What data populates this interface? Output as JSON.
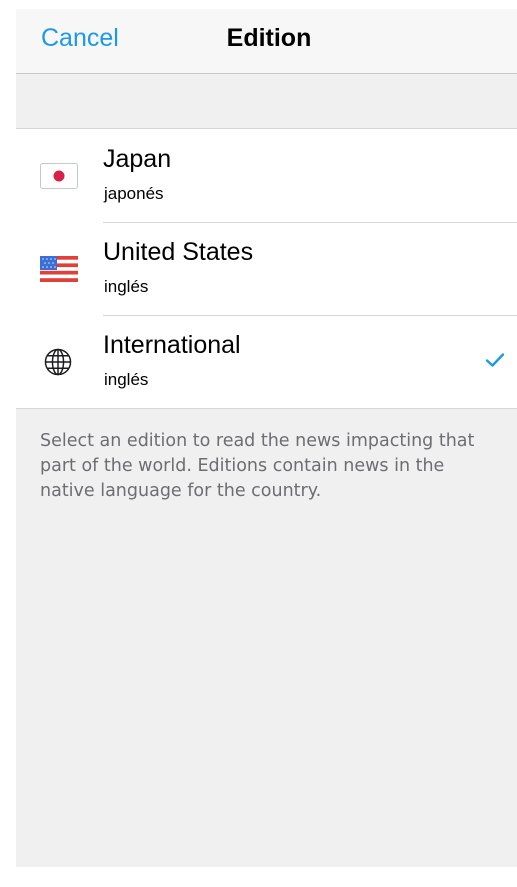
{
  "nav": {
    "cancel_label": "Cancel",
    "title": "Edition"
  },
  "editions": [
    {
      "name": "Japan",
      "language": "japonés",
      "icon": "japan-flag-icon",
      "selected": false
    },
    {
      "name": "United States",
      "language": "inglés",
      "icon": "us-flag-icon",
      "selected": false
    },
    {
      "name": "International",
      "language": "inglés",
      "icon": "globe-icon",
      "selected": true
    }
  ],
  "footer_note": "Select an edition to read the news impacting that part of the world. Editions contain news in the native language for the country.",
  "colors": {
    "accent": "#1a9ae8",
    "background": "#f0f0f1",
    "secondary_text": "#6d6d72",
    "japan_red": "#d8204a",
    "us_red": "#e0403a",
    "us_blue": "#3a6fd8"
  }
}
